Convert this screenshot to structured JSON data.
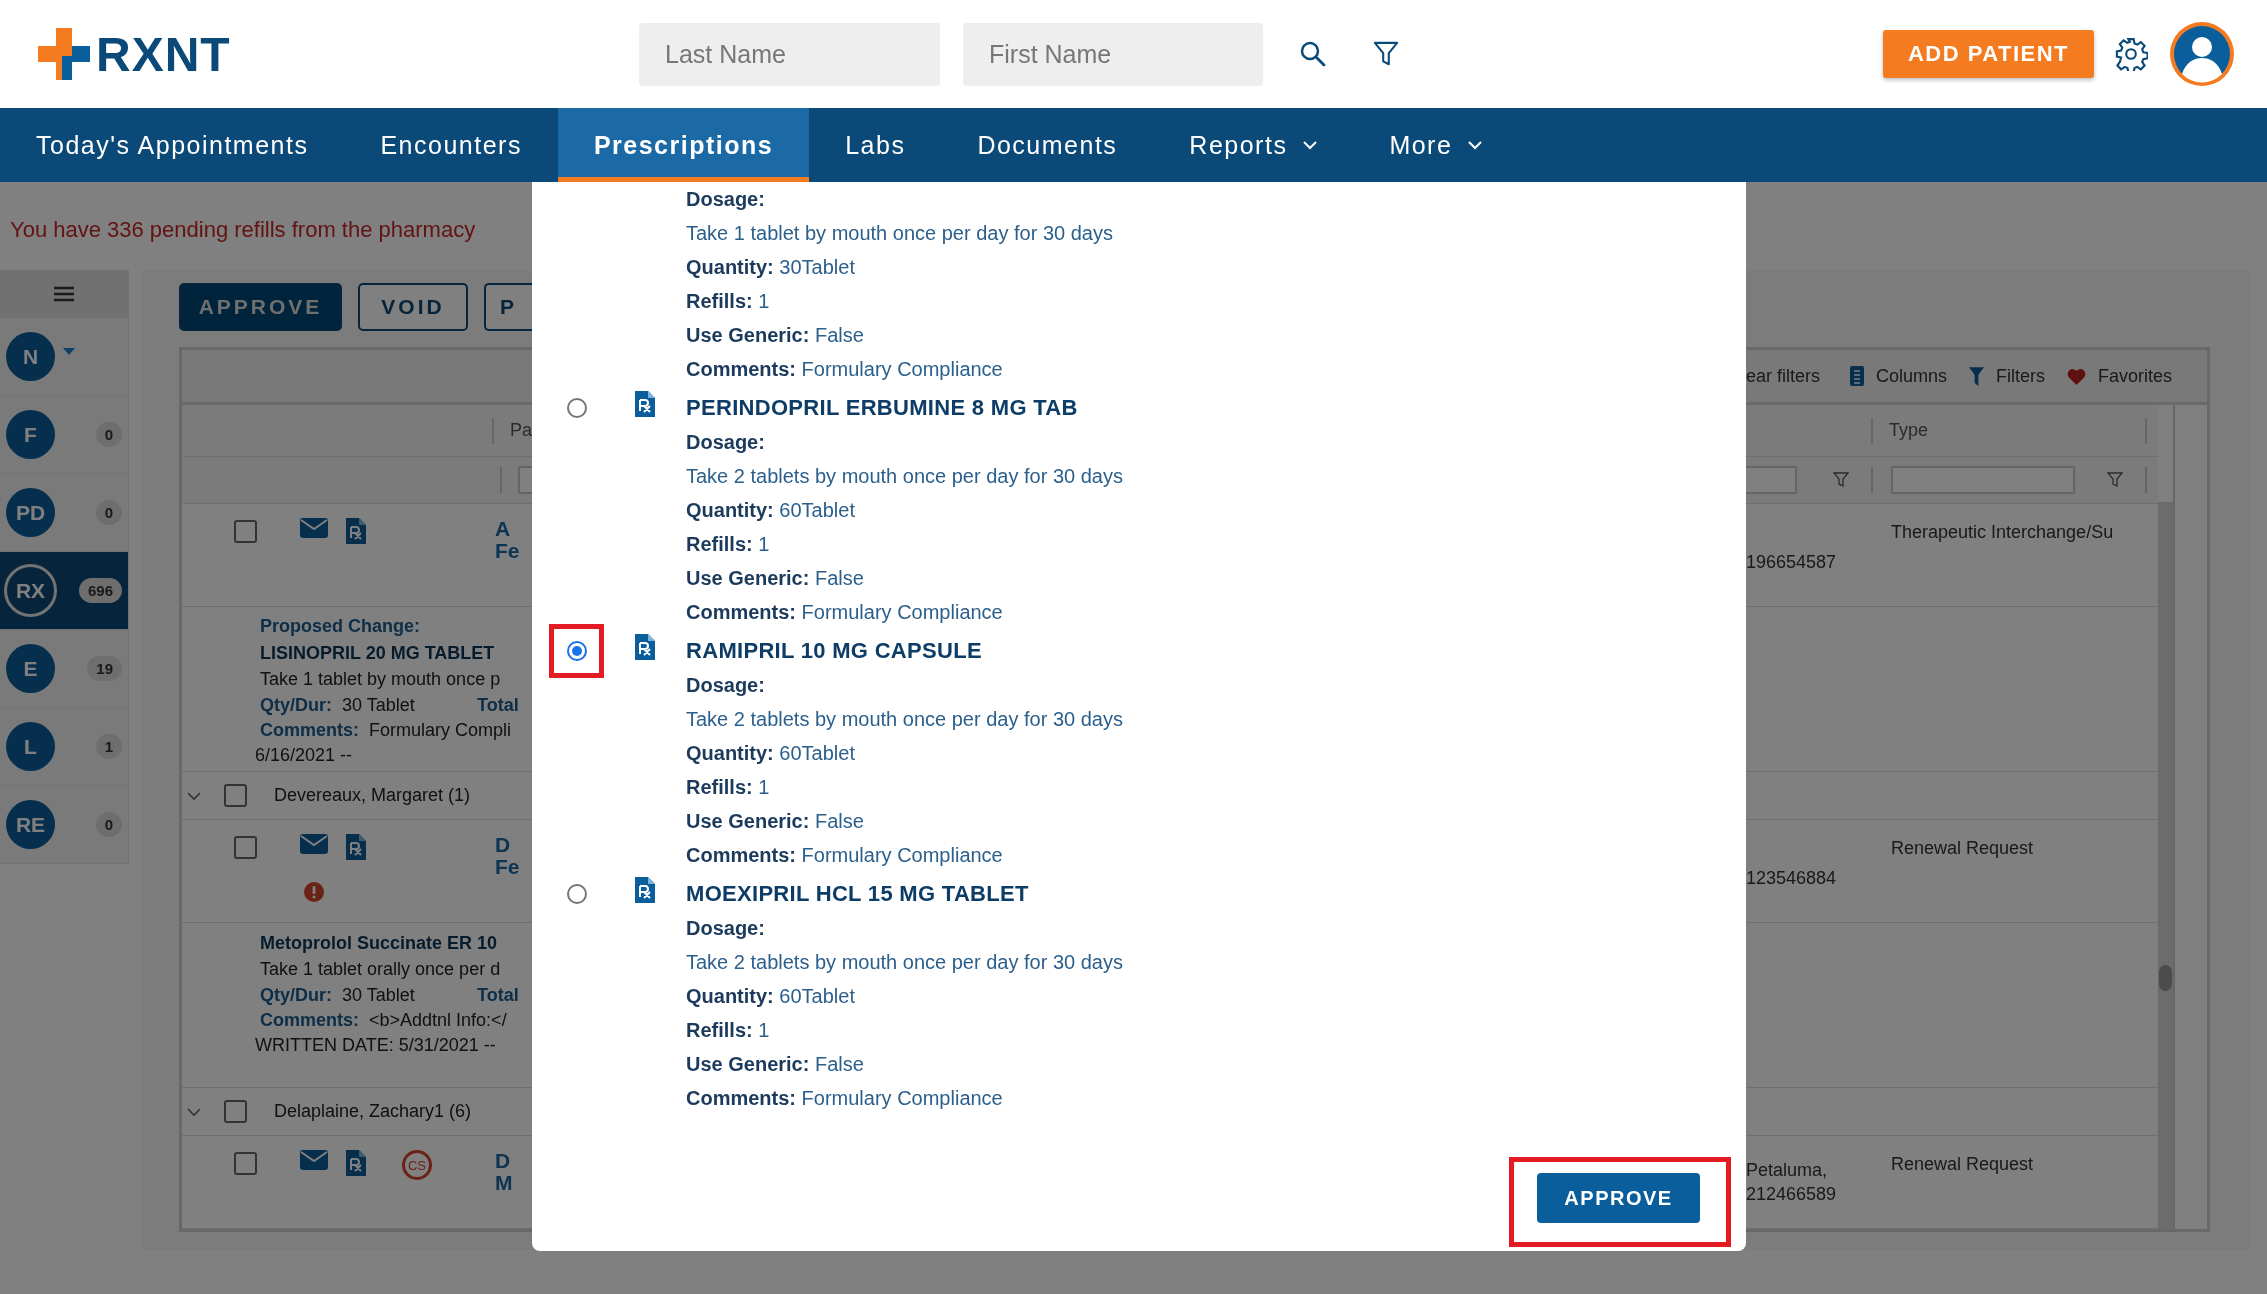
{
  "header": {
    "logo_text": "RXNT",
    "last_name": {
      "placeholder": "Last Name"
    },
    "first_name": {
      "placeholder": "First Name"
    },
    "add_patient": "ADD PATIENT"
  },
  "nav": [
    {
      "label": "Today's Appointments",
      "selected": false,
      "has_menu": false
    },
    {
      "label": "Encounters",
      "selected": false,
      "has_menu": false
    },
    {
      "label": "Prescriptions",
      "selected": true,
      "has_menu": false
    },
    {
      "label": "Labs",
      "selected": false,
      "has_menu": false
    },
    {
      "label": "Documents",
      "selected": false,
      "has_menu": false
    },
    {
      "label": "Reports",
      "selected": false,
      "has_menu": true
    },
    {
      "label": "More",
      "selected": false,
      "has_menu": true
    }
  ],
  "refill_notice": "You have 336 pending refills from the pharmacy",
  "sidebar": [
    {
      "label": "N",
      "selected": false,
      "has_dropdown": true
    },
    {
      "label": "F",
      "count": "0",
      "selected": false,
      "has_dropdown": false
    },
    {
      "label": "PD",
      "count": "0",
      "selected": false,
      "has_dropdown": false
    },
    {
      "label": "RX",
      "count": "696",
      "selected": true,
      "has_dropdown": false
    },
    {
      "label": "E",
      "count": "19",
      "selected": false,
      "has_dropdown": false
    },
    {
      "label": "L",
      "count": "1",
      "selected": false,
      "has_dropdown": false
    },
    {
      "label": "RE",
      "count": "0",
      "selected": false,
      "has_dropdown": false
    }
  ],
  "actions": [
    {
      "label": "APPROVE",
      "kind": "primary"
    },
    {
      "label": "VOID",
      "kind": "outline"
    },
    {
      "label": "P",
      "kind": "outline"
    }
  ],
  "grid": {
    "toolbar": [
      {
        "label": "ear filters",
        "kind": "text"
      },
      {
        "label": "Columns",
        "kind": "columns"
      },
      {
        "label": "Filters",
        "kind": "filters"
      },
      {
        "label": "Favorites",
        "kind": "favorites"
      }
    ],
    "columns": [
      "Pa",
      "Type"
    ],
    "rows": [
      {
        "kind": "data",
        "checked": false,
        "warning": false,
        "patient": [
          "A",
          "Fe"
        ],
        "pharmacy": [
          "196654587"
        ],
        "type": "Therapeutic Interchange/Su"
      },
      {
        "kind": "detail",
        "heading": "Proposed Change:",
        "drug": "LISINOPRIL 20 MG TABLET",
        "directions": "Take 1 tablet by mouth once p",
        "qty_label": "Qty/Dur:",
        "qty": "30 Tablet",
        "total_label": "Total",
        "comments_label": "Comments:",
        "comments": "Formulary Compli",
        "date": "6/16/2021 --"
      },
      {
        "kind": "group",
        "label": "Devereaux, Margaret (1)",
        "expanded": true,
        "checked": false
      },
      {
        "kind": "data",
        "checked": false,
        "warning": true,
        "patient": [
          "D",
          "Fe"
        ],
        "pharmacy": [
          "123546884"
        ],
        "type": "Renewal Request"
      },
      {
        "kind": "detail",
        "drug": "Metoprolol Succinate ER 10",
        "directions": "Take 1 tablet orally once per d",
        "qty_label": "Qty/Dur:",
        "qty": "30 Tablet",
        "total_label": "Total",
        "comments_label": "Comments:",
        "comments": "<b>Addtnl Info:</",
        "date": "WRITTEN DATE: 5/31/2021 --"
      },
      {
        "kind": "group",
        "label": "Delaplaine, Zachary1 (6)",
        "expanded": true,
        "checked": false
      },
      {
        "kind": "data",
        "checked": false,
        "warning": false,
        "badge": "CS",
        "patient": [
          "D",
          "M"
        ],
        "pharmacy": [
          "Petaluma,",
          "212466589"
        ],
        "type": "Renewal Request"
      }
    ]
  },
  "modal": {
    "top_item": {
      "dosage_label": "Dosage:",
      "dosage": "Take 1 tablet by mouth once per day for 30 days",
      "fields": [
        {
          "label": "Quantity:",
          "value": "30Tablet"
        },
        {
          "label": "Refills:",
          "value": "1"
        },
        {
          "label": "Use Generic:",
          "value": "False"
        },
        {
          "label": "Comments:",
          "value": "Formulary Compliance"
        }
      ]
    },
    "options": [
      {
        "name": "PERINDOPRIL ERBUMINE 8 MG TAB",
        "selected": false,
        "highlighted": false,
        "dosage_label": "Dosage:",
        "dosage": "Take 2 tablets by mouth once per day for 30 days",
        "fields": [
          {
            "label": "Quantity:",
            "value": "60Tablet"
          },
          {
            "label": "Refills:",
            "value": "1"
          },
          {
            "label": "Use Generic:",
            "value": "False"
          },
          {
            "label": "Comments:",
            "value": "Formulary Compliance"
          }
        ]
      },
      {
        "name": "RAMIPRIL 10 MG CAPSULE",
        "selected": true,
        "highlighted": true,
        "dosage_label": "Dosage:",
        "dosage": "Take 2 tablets by mouth once per day for 30 days",
        "fields": [
          {
            "label": "Quantity:",
            "value": "60Tablet"
          },
          {
            "label": "Refills:",
            "value": "1"
          },
          {
            "label": "Use Generic:",
            "value": "False"
          },
          {
            "label": "Comments:",
            "value": "Formulary Compliance"
          }
        ]
      },
      {
        "name": "MOEXIPRIL HCL 15 MG TABLET",
        "selected": false,
        "highlighted": false,
        "dosage_label": "Dosage:",
        "dosage": "Take 2 tablets by mouth once per day for 30 days",
        "fields": [
          {
            "label": "Quantity:",
            "value": "60Tablet"
          },
          {
            "label": "Refills:",
            "value": "1"
          },
          {
            "label": "Use Generic:",
            "value": "False"
          },
          {
            "label": "Comments:",
            "value": "Formulary Compliance"
          }
        ]
      }
    ],
    "approve": {
      "label": "APPROVE",
      "highlighted": true
    }
  }
}
